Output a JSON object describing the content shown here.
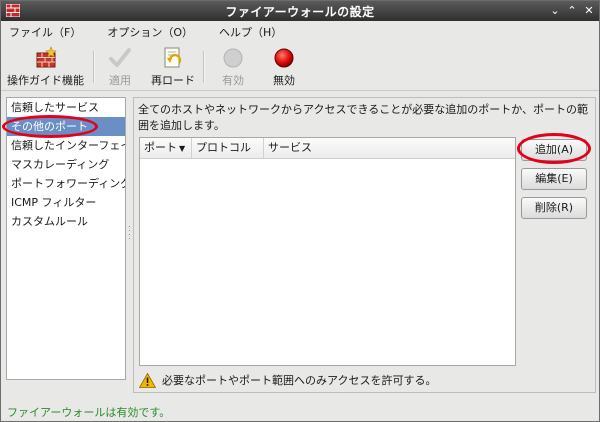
{
  "window": {
    "title": "ファイアーウォールの設定",
    "controls": {
      "minimize": "⌄",
      "maximize": "⌃",
      "close": "✕"
    }
  },
  "menu": [
    "ファイル（F）",
    "オプション（O）",
    "ヘルプ（H）"
  ],
  "toolbar": {
    "wizard": "操作ガイド機能",
    "apply": "適用",
    "reload": "再ロード",
    "enable": "有効",
    "disable": "無効"
  },
  "sidebar": {
    "items": [
      {
        "label": "信頼したサービス"
      },
      {
        "label": "その他のポート",
        "selected": true
      },
      {
        "label": "信頼したインターフェイ"
      },
      {
        "label": "マスカレーディング"
      },
      {
        "label": "ポートフォワーディング"
      },
      {
        "label": "ICMP フィルター"
      },
      {
        "label": "カスタムルール"
      }
    ]
  },
  "main": {
    "description": "全てのホストやネットワークからアクセスできることが必要な追加のポートか、ポートの範囲を追加します。",
    "table": {
      "columns": [
        "ポート",
        "プロトコル",
        "サービス"
      ],
      "rows": []
    },
    "buttons": {
      "add": "追加(A)",
      "edit": "編集(E)",
      "delete": "削除(R)"
    },
    "warning": "必要なポートやポート範囲へのみアクセスを許可する。"
  },
  "status": "ファイアーウォールは有効です。",
  "colors": {
    "selection": "#6a8fc4",
    "annotation": "#e4001b",
    "status_text": "#2b8a2b"
  }
}
